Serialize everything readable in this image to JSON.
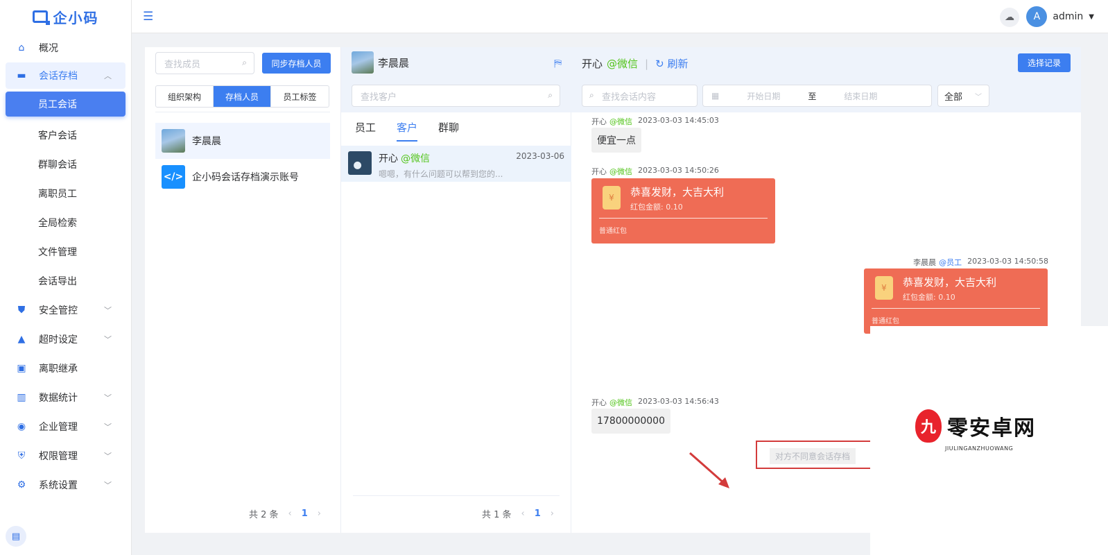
{
  "brand": {
    "name": "企小码"
  },
  "sidebar": {
    "overview": "概况",
    "archive": "会话存档",
    "archive_items": [
      "员工会话",
      "客户会话",
      "群聊会话",
      "离职员工",
      "全局检索",
      "文件管理",
      "会话导出"
    ],
    "groups": [
      {
        "label": "安全管控",
        "icon": "shield-icon",
        "expand": true
      },
      {
        "label": "超时设定",
        "icon": "bell-icon",
        "expand": true
      },
      {
        "label": "离职继承",
        "icon": "person-card-icon",
        "expand": false
      },
      {
        "label": "数据统计",
        "icon": "bar-chart-icon",
        "expand": true
      },
      {
        "label": "企业管理",
        "icon": "cycle-icon",
        "expand": true
      },
      {
        "label": "权限管理",
        "icon": "lock-shield-icon",
        "expand": true
      },
      {
        "label": "系统设置",
        "icon": "gear-icon",
        "expand": true
      }
    ]
  },
  "header": {
    "username": "admin",
    "avatar_letter": "A"
  },
  "members": {
    "search_placeholder": "查找成员",
    "sync_button": "同步存档人员",
    "tabs": [
      "组织架构",
      "存档人员",
      "员工标签"
    ],
    "active_tab": 1,
    "list": [
      {
        "name": "李晨晨"
      },
      {
        "name": "企小码会话存档演示账号"
      }
    ],
    "pager": {
      "total": "共 2 条",
      "page": "1"
    }
  },
  "customers": {
    "current_user": "李晨晨",
    "search_placeholder": "查找客户",
    "tabs": [
      "员工",
      "客户",
      "群聊"
    ],
    "active_tab": 1,
    "conversations": [
      {
        "name": "开心",
        "source": "@微信",
        "date": "2023-03-06",
        "preview": "嗯嗯，有什么问题可以帮到您的..."
      }
    ],
    "pager": {
      "total": "共 1 条",
      "page": "1"
    }
  },
  "chat": {
    "title_name": "开心",
    "title_source": "@微信",
    "refresh": "刷新",
    "select_button": "选择记录",
    "search_placeholder": "查找会话内容",
    "start_placeholder": "开始日期",
    "to_label": "至",
    "end_placeholder": "结束日期",
    "filter_value": "全部",
    "messages": [
      {
        "name": "开心",
        "source": "@微信",
        "time": "2023-03-03 14:45:03",
        "text": "便宜一点"
      },
      {
        "name": "开心",
        "source": "@微信",
        "time": "2023-03-03 14:50:26",
        "rp_title": "恭喜发财，大吉大利",
        "rp_amount": "红包金额: 0.10",
        "rp_type": "普通红包"
      },
      {
        "name": "李晨晨",
        "source": "@员工",
        "time": "2023-03-03 14:50:58",
        "rp_title": "恭喜发财，大吉大利",
        "rp_amount": "红包金额: 0.10",
        "rp_type": "普通红包"
      },
      {
        "name": "开心",
        "source": "@微信",
        "time": "2023-03-03 14:56:43",
        "text": "17800000000"
      }
    ],
    "notice": "对方不同意会话存档"
  },
  "watermark": {
    "text": "零安卓网",
    "sub": "JIULINGANZHUOWANG",
    "glyph": "九"
  }
}
